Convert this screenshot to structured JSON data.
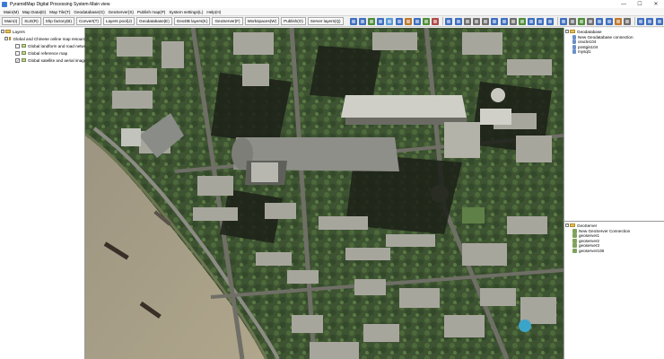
{
  "window": {
    "title": "PyramidMap Digital Processing System-Main view",
    "controls": [
      "—",
      "☐",
      "✕"
    ]
  },
  "menubar": [
    "Main(M)",
    "Map Data(D)",
    "Map Tile(T)",
    "Geodatabase(G)",
    "GeoServer(S)",
    "Publish map(P)",
    "System settings(L)",
    "Help(H)"
  ],
  "toolbar": {
    "buttons": [
      "Main(I)",
      "SLD(R)",
      "Shp factory(B)",
      "Convert(T)",
      "Layers pool(J)",
      "Geodatabase(E)",
      "GeoDB layers(K)",
      "GeoServer(F)",
      "Workspaces(W)",
      "Publish(O)",
      "Server layers(Q)"
    ],
    "icons": [
      {
        "name": "zoom-in-icon",
        "color": "#3f6fc0"
      },
      {
        "name": "zoom-out-icon",
        "color": "#3f6fc0"
      },
      {
        "name": "full-extent-icon",
        "color": "#4f8f3a"
      },
      {
        "name": "pan-icon",
        "color": "#3f6fc0"
      },
      {
        "name": "select-icon",
        "color": "#5a9bd5"
      },
      {
        "name": "identify-icon",
        "color": "#3f6fc0"
      },
      {
        "name": "measure-icon",
        "color": "#c07a2f"
      },
      {
        "name": "refresh-icon",
        "color": "#3f6fc0"
      },
      {
        "name": "layer-add-icon",
        "color": "#4f8f3a"
      },
      {
        "name": "layer-remove-icon",
        "color": "#b04a4a"
      },
      {
        "name": "previous-extent-icon",
        "color": "#3f6fc0"
      },
      {
        "name": "next-extent-icon",
        "color": "#3f6fc0"
      },
      {
        "name": "draw-point-icon",
        "color": "#6f6f6f"
      },
      {
        "name": "draw-line-icon",
        "color": "#6f6f6f"
      },
      {
        "name": "draw-polygon-icon",
        "color": "#6f6f6f"
      },
      {
        "name": "edit-icon",
        "color": "#3f6fc0"
      },
      {
        "name": "save-icon",
        "color": "#3f6fc0"
      },
      {
        "name": "print-icon",
        "color": "#6f6f6f"
      },
      {
        "name": "export-icon",
        "color": "#4f8f3a"
      },
      {
        "name": "copy-icon",
        "color": "#3f6fc0"
      },
      {
        "name": "paste-icon",
        "color": "#3f6fc0"
      },
      {
        "name": "undo-icon",
        "color": "#3f6fc0"
      },
      {
        "name": "redo-icon",
        "color": "#3f6fc0"
      },
      {
        "name": "table-icon",
        "color": "#6f6f6f"
      },
      {
        "name": "chart-icon",
        "color": "#4f8f3a"
      },
      {
        "name": "grid-icon",
        "color": "#6f6f6f"
      },
      {
        "name": "tile-icon",
        "color": "#3f6fc0"
      },
      {
        "name": "cache-icon",
        "color": "#3f6fc0"
      },
      {
        "name": "publish-icon",
        "color": "#c07a2f"
      },
      {
        "name": "settings-icon",
        "color": "#6f6f6f"
      },
      {
        "name": "user-icon",
        "color": "#3f6fc0"
      },
      {
        "name": "globe-icon",
        "color": "#3f6fc0"
      },
      {
        "name": "sync-icon",
        "color": "#3f6fc0"
      },
      {
        "name": "home-icon",
        "color": "#4f8f3a"
      },
      {
        "name": "help-icon",
        "color": "#3f6fc0"
      }
    ]
  },
  "layers": {
    "title": "Layers",
    "group": "Global and Chinese online map resources",
    "items": [
      {
        "label": "Global landform and road network",
        "checked": false
      },
      {
        "label": "Global reference map",
        "checked": false
      },
      {
        "label": "Global satellite and aerial imagery",
        "checked": true
      }
    ]
  },
  "geodatabase": {
    "title": "Geodatabase",
    "items": [
      "New Geodatabase connection",
      "oracle104",
      "postgis104",
      "mysql1"
    ]
  },
  "geoserver": {
    "title": "GeoServer",
    "items": [
      "New GeoServer Connection",
      "geoserver1",
      "geoserver2",
      "geoserver3",
      "geoserver108"
    ]
  },
  "colors": {
    "accent": "#3f6fc0",
    "river": "#a89f86",
    "vegetation": "#3f5a32"
  }
}
